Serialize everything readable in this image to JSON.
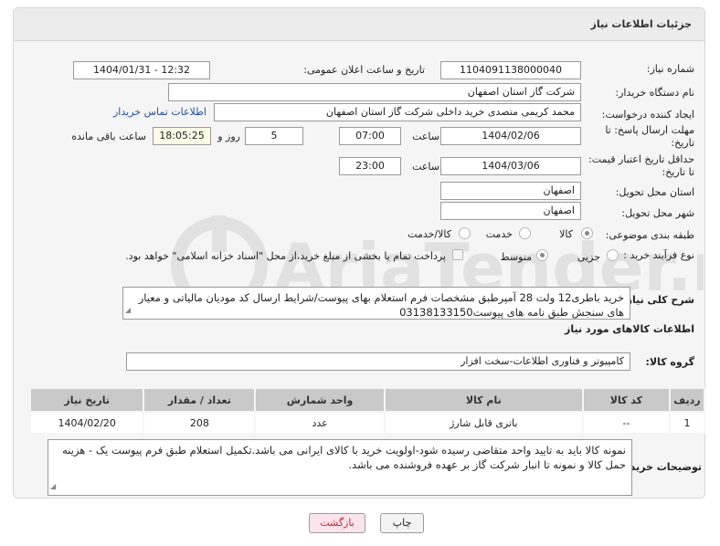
{
  "header": {
    "title": "جزئیات اطلاعات نیاز"
  },
  "form": {
    "need_number_label": "شماره نیاز:",
    "need_number": "1104091138000040",
    "announce_label": "تاریخ و ساعت اعلان عمومی:",
    "announce_value": "1404/01/31 - 12:32",
    "buyer_org_label": "نام دستگاه خریدار:",
    "buyer_org": "شرکت گاز استان اصفهان",
    "requester_label": "ایجاد کننده درخواست:",
    "requester": "محمد کریمی متصدی خرید داخلی شرکت گاز استان اصفهان",
    "contact_link": "اطلاعات تماس خریدار",
    "reply_deadline_label_1": "مهلت ارسال پاسخ: تا",
    "reply_deadline_label_2": "تاریخ:",
    "reply_date": "1404/02/06",
    "time_label": "ساعت",
    "reply_time": "07:00",
    "days_value": "5",
    "days_label": "روز و",
    "remaining_time": "18:05:25",
    "remaining_label": "ساعت باقی مانده",
    "price_validity_label_1": "حداقل تاریخ اعتبار قیمت:",
    "price_validity_label_2": "تا تاریخ:",
    "price_date": "1404/03/06",
    "price_time": "23:00",
    "province_label": "استان محل تحویل:",
    "province": "اصفهان",
    "city_label": "شهر محل تحویل:",
    "city": "اصفهان",
    "category_label": "طبقه بندی موضوعی:",
    "category_options": [
      "کالا",
      "خدمت",
      "کالا/خدمت"
    ],
    "category_selected": "کالا",
    "process_label": "نوع فرآیند خرید :",
    "process_options": [
      "جزیی",
      "متوسط"
    ],
    "process_selected": "متوسط",
    "payment_note": "پرداخت تمام یا بخشی از مبلغ خرید،از محل \"اسناد خزانه اسلامی\" خواهد بود.",
    "description_label": "شرح کلی نیاز:",
    "description": "خرید باطری12 ولت 28 آمپرطبق مشخصات فرم استعلام بهای پیوست/شرایط  ارسال کد مودیان مالیاتی و معیار های سنجش طبق نامه های پیوست03138133150"
  },
  "goods": {
    "section_title": "اطلاعات کالاهای مورد نیاز",
    "group_label": "گروه کالا:",
    "group_value": "کامپیوتر و فناوری اطلاعات-سخت افزار",
    "columns": [
      "ردیف",
      "کد کالا",
      "نام کالا",
      "واحد شمارش",
      "تعداد / مقدار",
      "تاریخ نیاز"
    ],
    "rows": [
      [
        "1",
        "--",
        "باتری قابل شارژ",
        "عدد",
        "208",
        "1404/02/20"
      ]
    ]
  },
  "buyer_notes": {
    "label": "توضیحات خریدار:",
    "text": "نمونه کالا باید به تایید واحد متقاضی رسیده شود-اولویت خرید با کالای ایرانی می باشد.تکمیل استعلام طبق فرم پیوست یک - هزینه حمل کالا و نمونه تا انبار شرکت گاز بر عهده فروشنده می باشد."
  },
  "buttons": {
    "print": "چاپ",
    "back": "بازگشت"
  },
  "watermark_text": "AriaTender.neT",
  "colors": {
    "link": "#1e4fa5",
    "back_button_bg": "#fce4ec",
    "time_bg": "#fffbe6"
  }
}
